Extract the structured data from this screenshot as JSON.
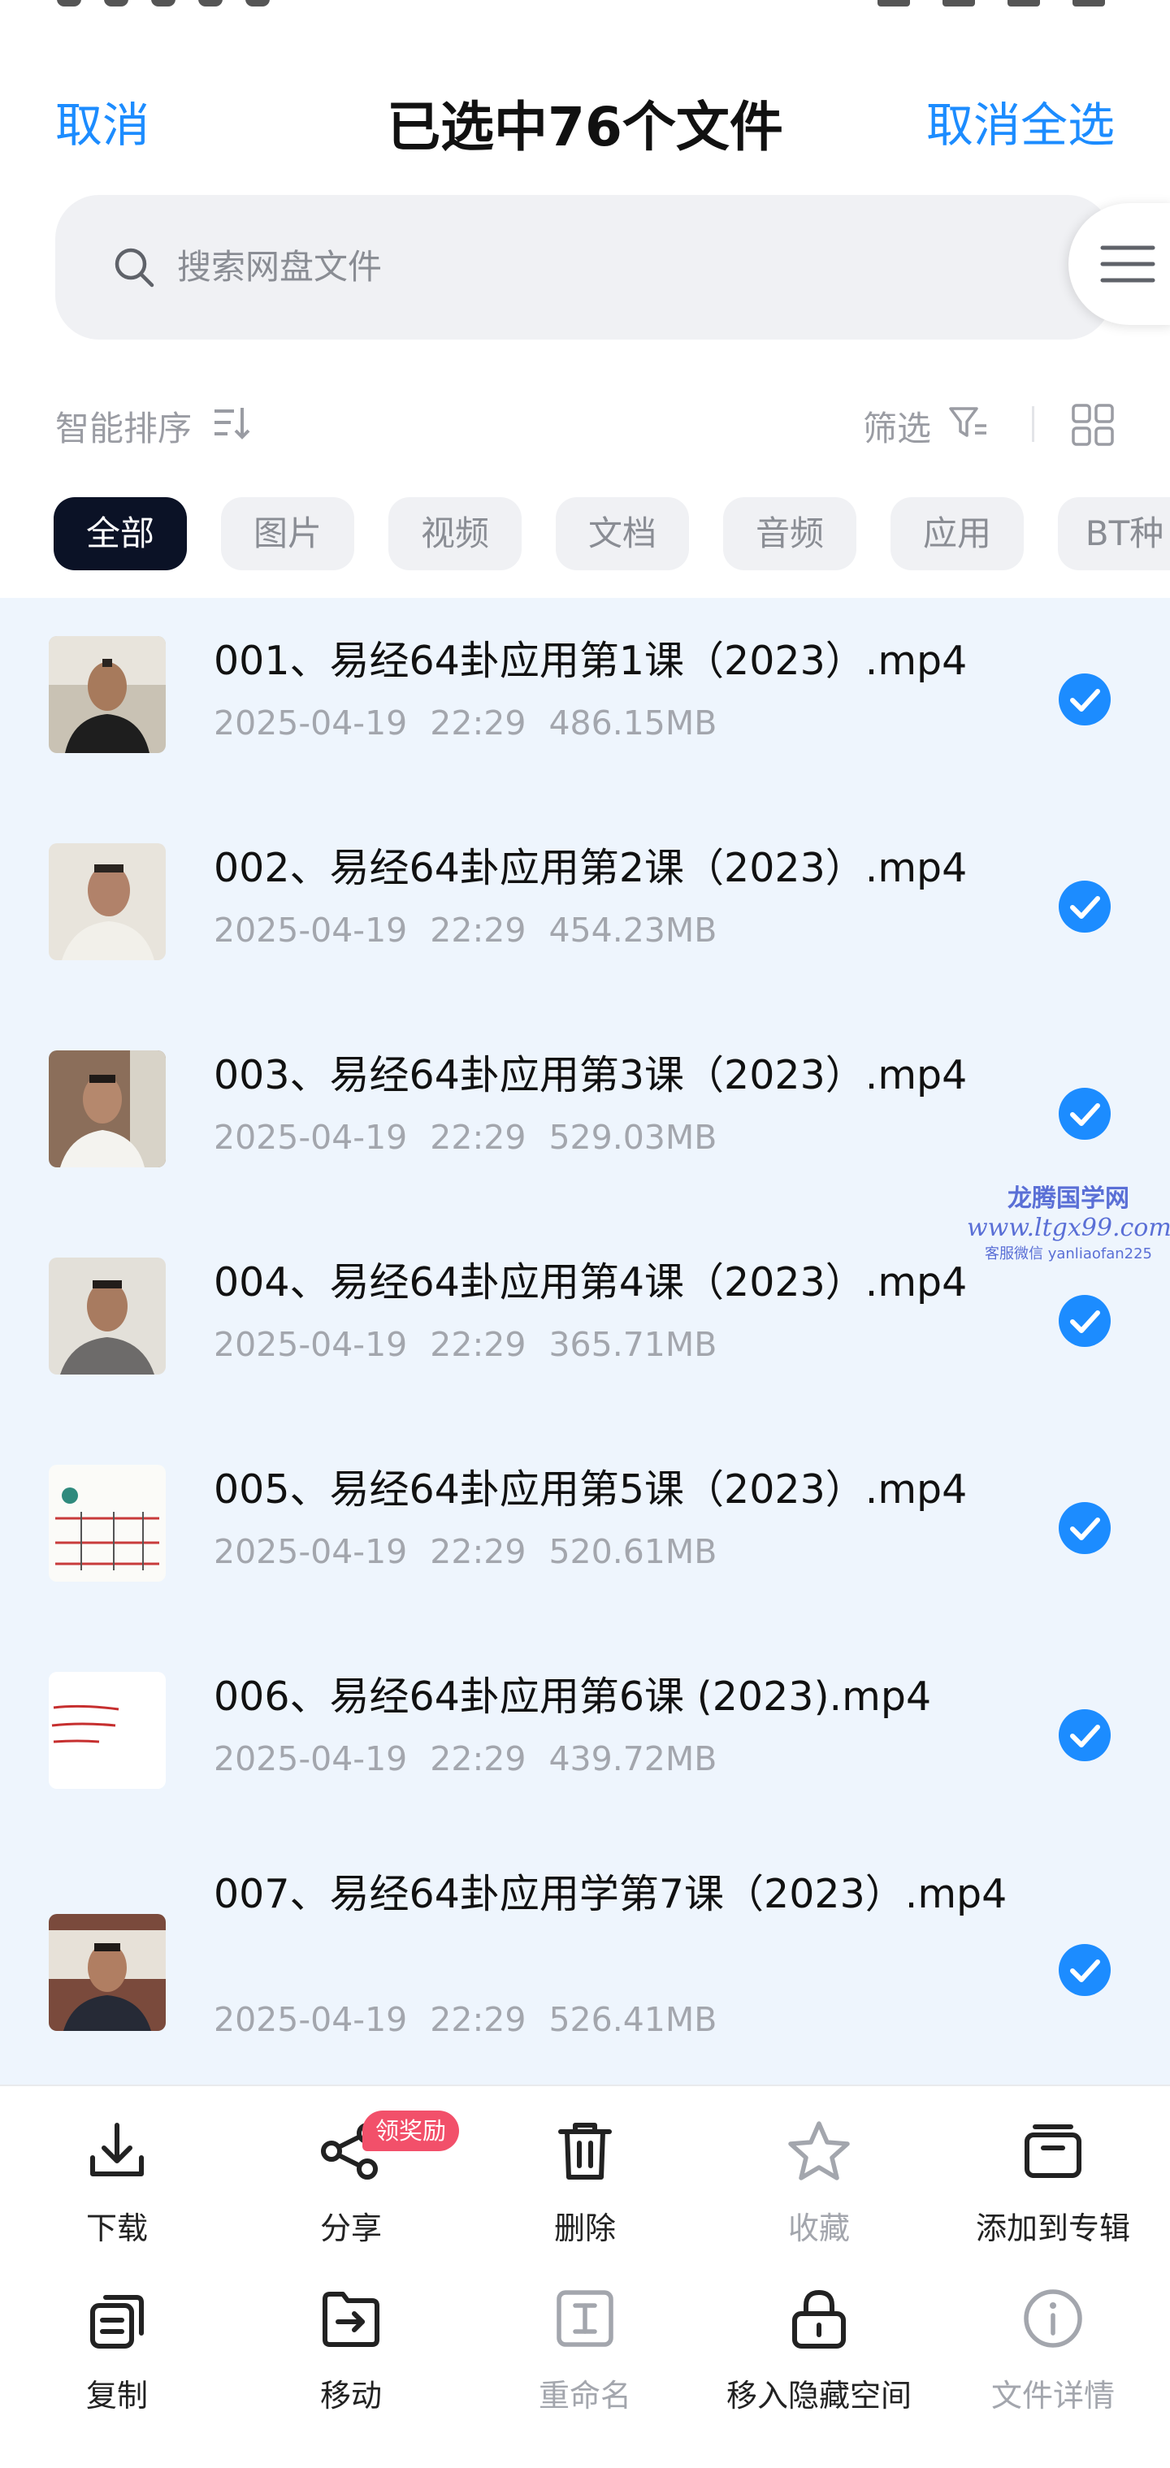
{
  "header": {
    "cancel_label": "取消",
    "title": "已选中76个文件",
    "deselect_all_label": "取消全选"
  },
  "search": {
    "placeholder": "搜索网盘文件"
  },
  "toolbar": {
    "sort_label": "智能排序",
    "filter_label": "筛选"
  },
  "tabs": [
    {
      "label": "全部",
      "active": true
    },
    {
      "label": "图片"
    },
    {
      "label": "视频"
    },
    {
      "label": "文档"
    },
    {
      "label": "音频"
    },
    {
      "label": "应用"
    },
    {
      "label": "BT种"
    }
  ],
  "files": [
    {
      "name": "001、易经64卦应用第1课（2023）.mp4",
      "date": "2025-04-19",
      "time": "22:29",
      "size": "486.15MB",
      "checked": true
    },
    {
      "name": "002、易经64卦应用第2课（2023）.mp4",
      "date": "2025-04-19",
      "time": "22:29",
      "size": "454.23MB",
      "checked": true
    },
    {
      "name": "003、易经64卦应用第3课（2023）.mp4",
      "date": "2025-04-19",
      "time": "22:29",
      "size": "529.03MB",
      "checked": true
    },
    {
      "name": "004、易经64卦应用第4课（2023）.mp4",
      "date": "2025-04-19",
      "time": "22:29",
      "size": "365.71MB",
      "checked": true
    },
    {
      "name": "005、易经64卦应用第5课（2023）.mp4",
      "date": "2025-04-19",
      "time": "22:29",
      "size": "520.61MB",
      "checked": true
    },
    {
      "name": "006、易经64卦应用第6课 (2023).mp4",
      "date": "2025-04-19",
      "time": "22:29",
      "size": "439.72MB",
      "checked": true
    },
    {
      "name": "007、易经64卦应用学第7课（2023）.mp4",
      "date": "2025-04-19",
      "time": "22:29",
      "size": "526.41MB",
      "checked": true
    }
  ],
  "watermark": {
    "line1": "龙腾国学网",
    "line2": "www.ltgx99.com",
    "line3": "客服微信 yanliaofan225"
  },
  "actions": {
    "download": "下载",
    "share": "分享",
    "share_badge": "领奖励",
    "delete": "删除",
    "favorite": "收藏",
    "add_to_album": "添加到专辑",
    "copy": "复制",
    "move": "移动",
    "rename": "重命名",
    "move_to_hidden": "移入隐藏空间",
    "file_details": "文件详情"
  },
  "colors": {
    "accent": "#1c8cff",
    "check": "#1c8cff",
    "active_tab_bg": "#0b1226",
    "badge": "#f2506a",
    "list_bg": "#eef5fd"
  }
}
